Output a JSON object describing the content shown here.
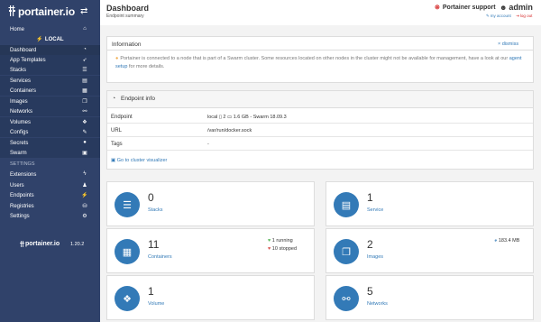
{
  "app": {
    "logo_text": "portainer.io",
    "toggle_icon": "arrows-swap-icon"
  },
  "sidebar": {
    "items": [
      {
        "label": "Home",
        "icon": "home-icon",
        "glyph": "⌂"
      },
      {
        "label": "LOCAL",
        "icon": "plug-icon",
        "glyph": "⚡"
      },
      {
        "label": "Dashboard",
        "icon": "tachometer-icon",
        "glyph": "◔"
      },
      {
        "label": "App Templates",
        "icon": "rocket-icon",
        "glyph": "➶"
      },
      {
        "label": "Stacks",
        "icon": "th-list-icon",
        "glyph": "☰"
      },
      {
        "label": "Services",
        "icon": "list-alt-icon",
        "glyph": "▤"
      },
      {
        "label": "Containers",
        "icon": "server-icon",
        "glyph": "▦"
      },
      {
        "label": "Images",
        "icon": "clone-icon",
        "glyph": "❐"
      },
      {
        "label": "Networks",
        "icon": "sitemap-icon",
        "glyph": "⚯"
      },
      {
        "label": "Volumes",
        "icon": "cubes-icon",
        "glyph": "❖"
      },
      {
        "label": "Configs",
        "icon": "file-code-icon",
        "glyph": "✎"
      },
      {
        "label": "Secrets",
        "icon": "user-secret-icon",
        "glyph": "●"
      },
      {
        "label": "Swarm",
        "icon": "object-group-icon",
        "glyph": "▣"
      }
    ],
    "settings_heading": "SETTINGS",
    "settings_items": [
      {
        "label": "Extensions",
        "icon": "bolt-icon",
        "glyph": "ϟ"
      },
      {
        "label": "Users",
        "icon": "users-icon",
        "glyph": "♟"
      },
      {
        "label": "Endpoints",
        "icon": "plug-icon",
        "glyph": "⚡"
      },
      {
        "label": "Registries",
        "icon": "database-icon",
        "glyph": "⛁"
      },
      {
        "label": "Settings",
        "icon": "cogs-icon",
        "glyph": "⚙"
      }
    ],
    "footer_logo": "portainer.io",
    "version": "1.20.2"
  },
  "header": {
    "title": "Dashboard",
    "subtitle": "Endpoint summary",
    "support_label": "Portainer support",
    "username": "admin",
    "my_account": "my account",
    "log_out": "log out"
  },
  "information": {
    "title": "Information",
    "dismiss": "dismiss",
    "text_before": "Portainer is connected to a node that is part of a Swarm cluster. Some resources located on other nodes in the cluster might not be available for management, have a look at our ",
    "link": "agent setup",
    "text_after": " for more details."
  },
  "endpoint_info": {
    "title": "Endpoint info",
    "rows": [
      {
        "key": "Endpoint",
        "value": "local  ▯ 2  ▭ 1.6 GB - Swarm 18.09.3"
      },
      {
        "key": "URL",
        "value": "/var/run/docker.sock"
      },
      {
        "key": "Tags",
        "value": "-"
      }
    ],
    "visualizer_link": "Go to cluster visualizer"
  },
  "stats": {
    "stacks": {
      "count": "0",
      "label": "Stacks"
    },
    "service": {
      "count": "1",
      "label": "Service"
    },
    "containers": {
      "count": "11",
      "label": "Containers",
      "running": "1 running",
      "stopped": "10 stopped"
    },
    "images": {
      "count": "2",
      "label": "Images",
      "size": "183.4 MB"
    },
    "volume": {
      "count": "1",
      "label": "Volume"
    },
    "networks": {
      "count": "5",
      "label": "Networks"
    }
  },
  "colors": {
    "sidebar": "#30426a",
    "accent": "#337ab7",
    "danger": "#d62c2c"
  }
}
